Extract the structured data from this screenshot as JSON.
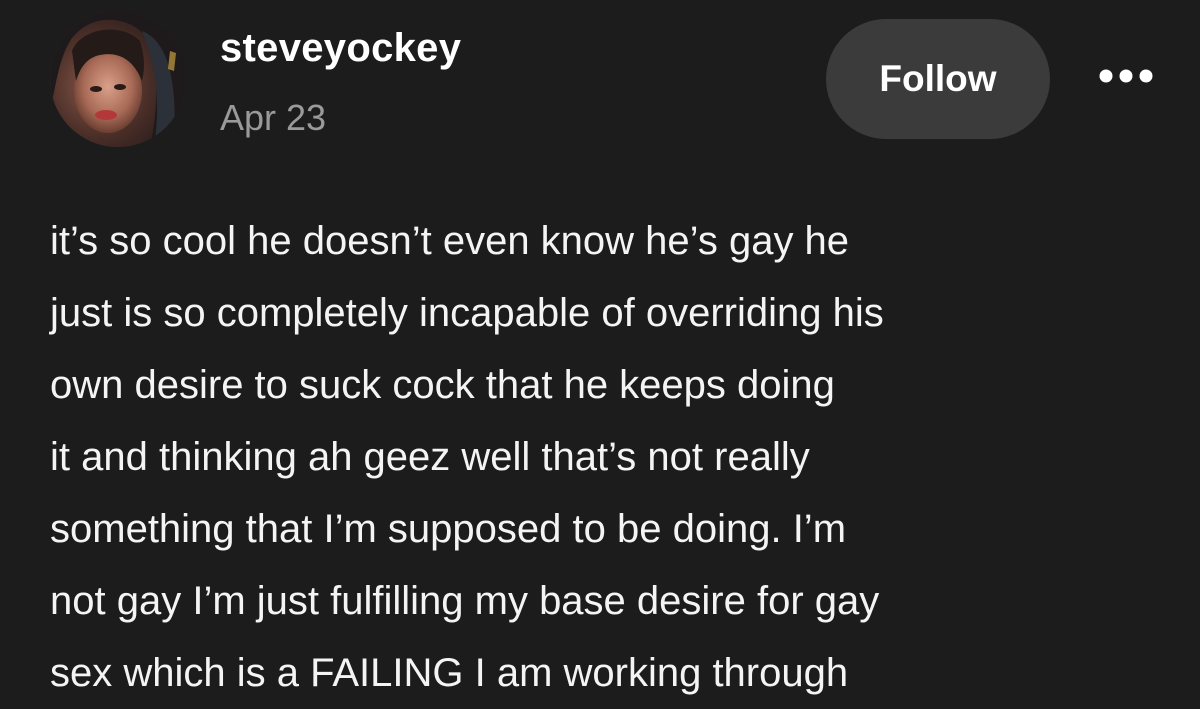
{
  "post": {
    "author": {
      "username": "steveyockey",
      "avatar_icon": "user-avatar"
    },
    "date": "Apr 23",
    "follow_label": "Follow",
    "more_icon": "more-horizontal-icon",
    "body_lines": [
      "it’s so cool he doesn’t even know he’s gay he",
      "just is so completely incapable of overriding his",
      "own desire to suck cock that he keeps doing",
      "it and thinking ah geez well that’s not really",
      "something that I’m supposed to be doing. I’m",
      "not gay I’m just fulfilling my base desire for gay",
      "sex which is a FAILING I am working through"
    ]
  },
  "colors": {
    "background": "#1c1c1c",
    "text": "#ffffff",
    "muted_text": "#9a9a9a",
    "follow_button_bg": "#3b3b3b"
  }
}
